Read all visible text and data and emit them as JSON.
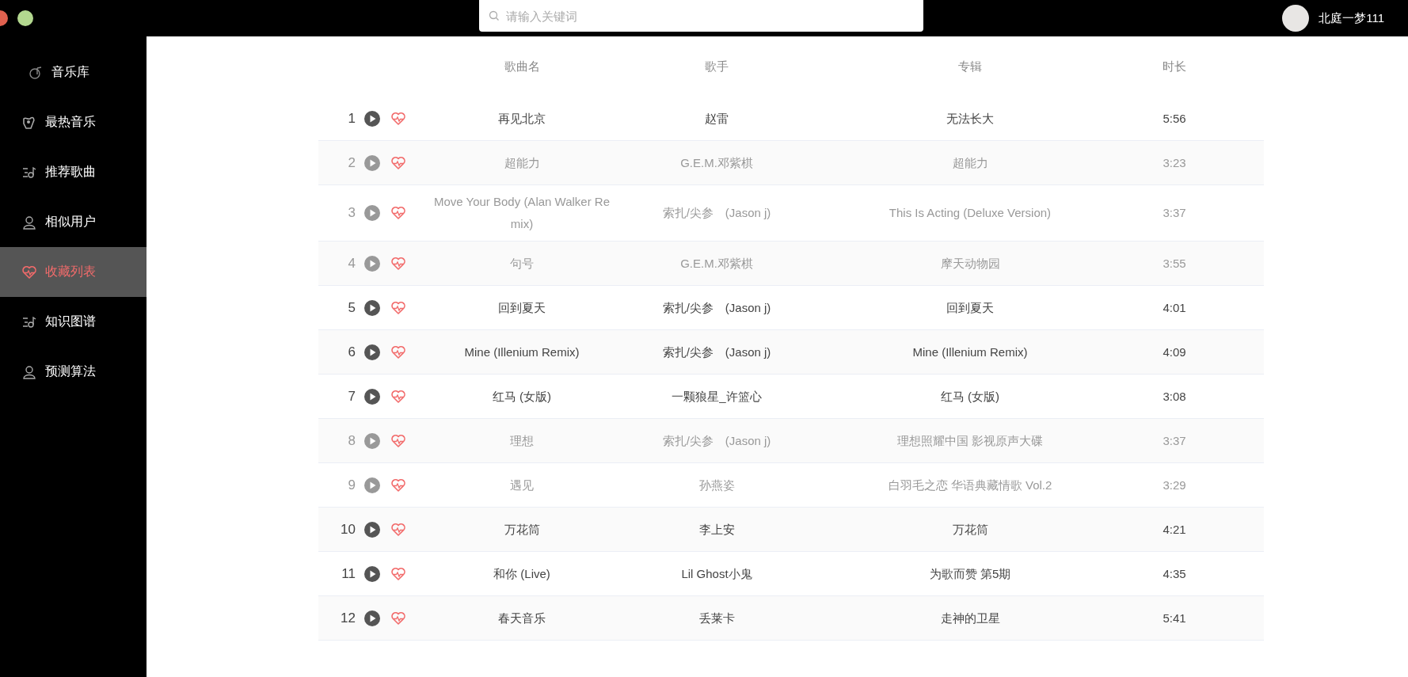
{
  "search": {
    "placeholder": "请输入关键词"
  },
  "user": {
    "name": "北庭一梦111"
  },
  "sidebar": {
    "items": [
      {
        "label": "音乐库",
        "selected": false
      },
      {
        "label": "最热音乐",
        "selected": false
      },
      {
        "label": "推荐歌曲",
        "selected": false
      },
      {
        "label": "相似用户",
        "selected": false
      },
      {
        "label": "收藏列表",
        "selected": true
      },
      {
        "label": "知识图谱",
        "selected": false
      },
      {
        "label": "预测算法",
        "selected": false
      }
    ]
  },
  "table": {
    "columns": [
      "歌曲名",
      "歌手",
      "专辑",
      "时长"
    ],
    "rows": [
      {
        "index": "1",
        "song": "再见北京",
        "singer": "赵雷",
        "album": "无法长大",
        "duration": "5:56",
        "disabled": false
      },
      {
        "index": "2",
        "song": "超能力",
        "singer": "G.E.M.邓紫棋",
        "album": "超能力",
        "duration": "3:23",
        "disabled": true
      },
      {
        "index": "3",
        "song": "Move Your Body (Alan Walker Remix)",
        "singer": "索扎/尖参　(Jason j)",
        "album": "This Is Acting (Deluxe Version)",
        "duration": "3:37",
        "disabled": true
      },
      {
        "index": "4",
        "song": "句号",
        "singer": "G.E.M.邓紫棋",
        "album": "摩天动物园",
        "duration": "3:55",
        "disabled": true
      },
      {
        "index": "5",
        "song": "回到夏天",
        "singer": "索扎/尖参　(Jason j)",
        "album": "回到夏天",
        "duration": "4:01",
        "disabled": false
      },
      {
        "index": "6",
        "song": "Mine (Illenium Remix)",
        "singer": "索扎/尖参　(Jason j)",
        "album": "Mine (Illenium Remix)",
        "duration": "4:09",
        "disabled": false
      },
      {
        "index": "7",
        "song": "红马 (女版)",
        "singer": "一颗狼星_许篮心",
        "album": "红马 (女版)",
        "duration": "3:08",
        "disabled": false
      },
      {
        "index": "8",
        "song": "理想",
        "singer": "索扎/尖参　(Jason j)",
        "album": "理想照耀中国 影视原声大碟",
        "duration": "3:37",
        "disabled": true
      },
      {
        "index": "9",
        "song": "遇见",
        "singer": "孙燕姿",
        "album": "白羽毛之恋 华语典藏情歌 Vol.2",
        "duration": "3:29",
        "disabled": true
      },
      {
        "index": "10",
        "song": "万花筒",
        "singer": "李上安",
        "album": "万花筒",
        "duration": "4:21",
        "disabled": false
      },
      {
        "index": "11",
        "song": "和你 (Live)",
        "singer": "Lil Ghost小鬼",
        "album": "为歌而赞 第5期",
        "duration": "4:35",
        "disabled": false
      },
      {
        "index": "12",
        "song": "春天音乐",
        "singer": "丢莱卡",
        "album": "走神的卫星",
        "duration": "5:41",
        "disabled": false
      }
    ]
  }
}
